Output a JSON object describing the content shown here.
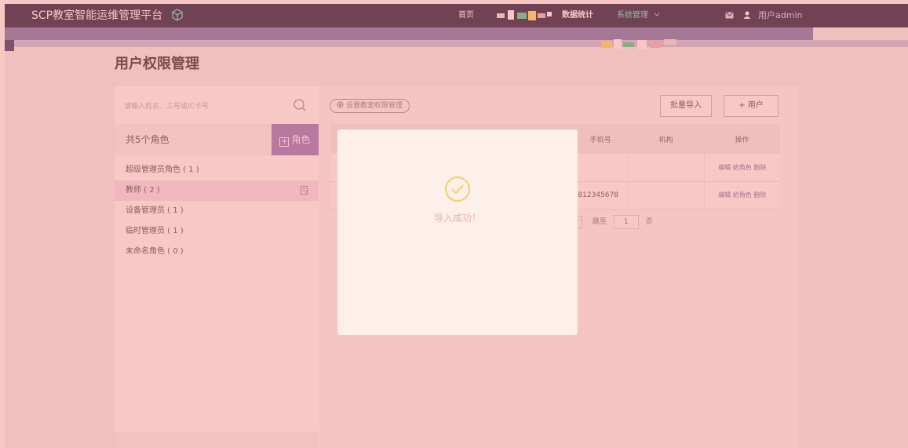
{
  "header": {
    "brand": "SCP教室智能运维管理平台",
    "nav": [
      {
        "label": "首页"
      },
      {
        "label": "数据统计"
      },
      {
        "label": "系统管理"
      }
    ],
    "user": "用户admin"
  },
  "page": {
    "title": "用户权限管理"
  },
  "sidebar": {
    "search_placeholder": "请输入姓名、工号或IC卡号",
    "roles_count_label": "共5个角色",
    "add_role_label": "角色",
    "roles": [
      {
        "label": "超级管理员角色 ( 1 )"
      },
      {
        "label": "教师 ( 2 )"
      },
      {
        "label": "设备管理员 ( 1 )"
      },
      {
        "label": "临时管理员 ( 1 )"
      },
      {
        "label": "未命名角色 ( 0 )"
      }
    ]
  },
  "main": {
    "perm_button": "设置教室权限管理",
    "import_button": "批量导入",
    "add_user_button": "+ 用户",
    "table": {
      "columns": [
        "手机号",
        "机构",
        "操作"
      ],
      "rows": [
        {
          "phone": "",
          "org": "",
          "ops": "编辑 给角色 删除"
        },
        {
          "phone": "5812345678",
          "org": "",
          "ops": "编辑 给角色 删除"
        }
      ]
    },
    "pager": {
      "goto_label": "跳至",
      "page_value": "1",
      "page_unit": "页"
    }
  },
  "toast": {
    "message": "导入成功！"
  },
  "colors": {
    "topbar": "#27284a",
    "accent_purple": "#9a7fc4",
    "nav_active": "#5ee8c9",
    "overlay": "#eb6e64"
  }
}
